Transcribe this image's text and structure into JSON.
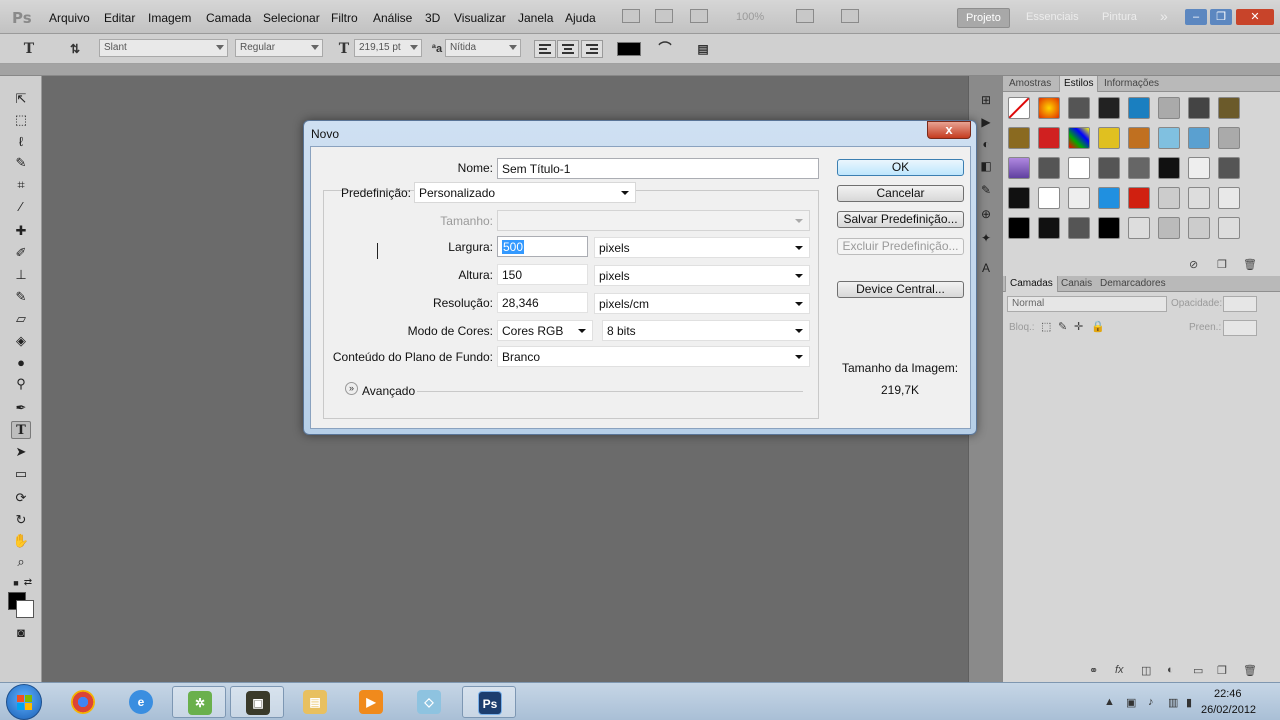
{
  "menubar": {
    "logo": "Ps",
    "items": [
      "Arquivo",
      "Editar",
      "Imagem",
      "Camada",
      "Selecionar",
      "Filtro",
      "Análise",
      "3D",
      "Visualizar",
      "Janela",
      "Ajuda"
    ],
    "zoom": "100%",
    "workspaces": [
      "Projeto",
      "Essenciais",
      "Pintura"
    ],
    "more": "»"
  },
  "options": {
    "font_family": "Slant",
    "font_style": "Regular",
    "font_size": "219,15 pt",
    "antialias": "Nítida",
    "text_color": "#000000"
  },
  "styles_panel": {
    "tabs": [
      "Amostras",
      "Estilos",
      "Informações"
    ],
    "active_tab": "Estilos"
  },
  "layers_panel": {
    "tabs": [
      "Camadas",
      "Canais",
      "Demarcadores"
    ],
    "active_tab": "Camadas",
    "blend_mode": "Normal",
    "opacity_label": "Opacidade:",
    "lock_label": "Bloq.:",
    "fill_label": "Preen.:"
  },
  "dialog": {
    "title": "Novo",
    "close": "x",
    "name_label": "Nome:",
    "name_value": "Sem Título-1",
    "preset_label": "Predefinição:",
    "preset_value": "Personalizado",
    "size_label": "Tamanho:",
    "size_value": "",
    "width_label": "Largura:",
    "width_value": "500",
    "width_unit": "pixels",
    "height_label": "Altura:",
    "height_value": "150",
    "height_unit": "pixels",
    "resolution_label": "Resolução:",
    "resolution_value": "28,346",
    "resolution_unit": "pixels/cm",
    "color_mode_label": "Modo de Cores:",
    "color_mode_value": "Cores RGB",
    "bit_depth": "8 bits",
    "background_label": "Conteúdo do Plano de Fundo:",
    "background_value": "Branco",
    "advanced_label": "Avançado",
    "ok": "OK",
    "cancel": "Cancelar",
    "save_preset": "Salvar Predefinição...",
    "delete_preset": "Excluir Predefinição...",
    "device_central": "Device Central...",
    "image_size_label": "Tamanho da Imagem:",
    "image_size_value": "219,7K"
  },
  "taskbar": {
    "ps_label": "Ps",
    "time": "22:46",
    "date": "26/02/2012"
  }
}
